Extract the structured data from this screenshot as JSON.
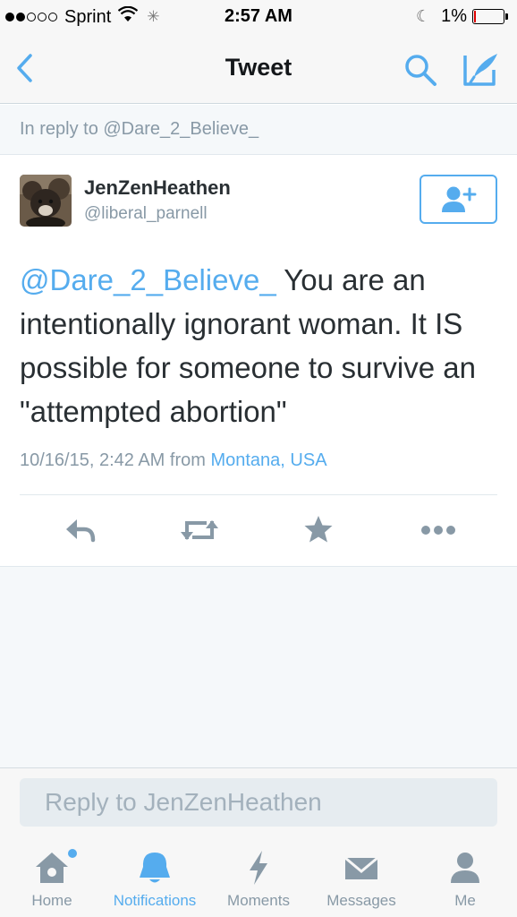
{
  "status_bar": {
    "carrier": "Sprint",
    "time": "2:57 AM",
    "battery": "1%"
  },
  "nav": {
    "title": "Tweet"
  },
  "reply_context": "In reply to @Dare_2_Believe_",
  "tweet": {
    "display_name": "JenZenHeathen",
    "handle": "@liberal_parnell",
    "mention": "@Dare_2_Believe_",
    "text": " You are an intentionally ignorant woman. It IS possible for someone to survive an \"attempted abortion\"",
    "timestamp": "10/16/15, 2:42 AM from",
    "location": "Montana, USA"
  },
  "reply": {
    "placeholder": "Reply to JenZenHeathen"
  },
  "tabs": [
    {
      "label": "Home",
      "icon": "home-icon"
    },
    {
      "label": "Notifications",
      "icon": "bell-icon"
    },
    {
      "label": "Moments",
      "icon": "lightning-icon"
    },
    {
      "label": "Messages",
      "icon": "envelope-icon"
    },
    {
      "label": "Me",
      "icon": "person-icon"
    }
  ],
  "colors": {
    "accent": "#55acee",
    "muted": "#8899a6",
    "text": "#292f33"
  }
}
